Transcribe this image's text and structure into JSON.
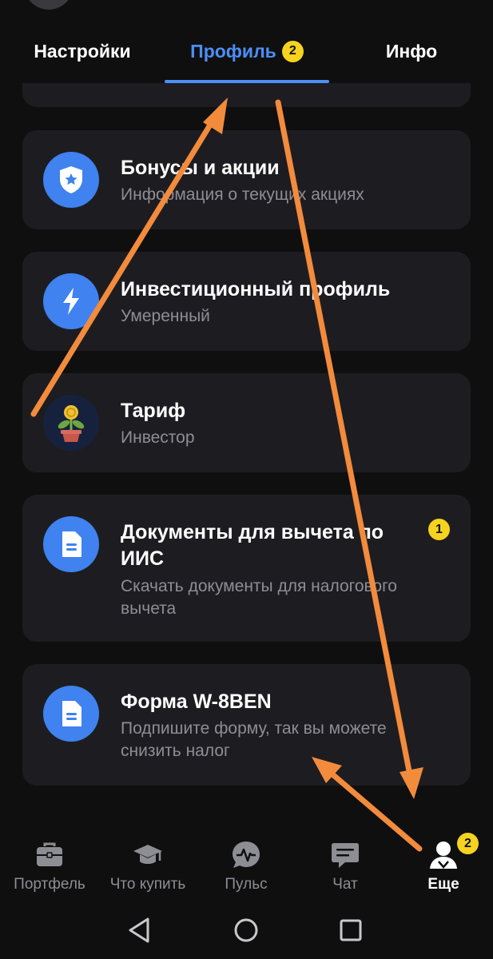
{
  "tabs": {
    "settings": "Настройки",
    "profile": "Профиль",
    "profile_badge": "2",
    "info": "Инфо",
    "active_color": "#4c8ff5"
  },
  "cards": [
    {
      "icon": "shield-star-icon",
      "title": "Бонусы и акции",
      "subtitle": "Информация о текущих акциях"
    },
    {
      "icon": "lightning-icon",
      "title": "Инвестиционный профиль",
      "subtitle": "Умеренный"
    },
    {
      "icon": "money-plant-icon",
      "title": "Тариф",
      "subtitle": "Инвестор"
    },
    {
      "icon": "document-icon",
      "title": "Документы для вычета по ИИС",
      "subtitle": "Скачать документы для налогового вычета",
      "badge": "1"
    },
    {
      "icon": "document-icon",
      "title": "Форма W-8BEN",
      "subtitle": "Подпишите форму, так вы можете снизить налог"
    }
  ],
  "bottom_nav": {
    "portfolio": "Портфель",
    "what_to_buy": "Что купить",
    "pulse": "Пульс",
    "chat": "Чат",
    "more": "Еще",
    "more_badge": "2"
  },
  "colors": {
    "background": "#0f0f10",
    "card": "#1d1d21",
    "accent": "#4c8ff5",
    "icon_circle": "#3f82f0",
    "badge": "#f5d31f",
    "annotation_arrow": "#f28b3c"
  }
}
